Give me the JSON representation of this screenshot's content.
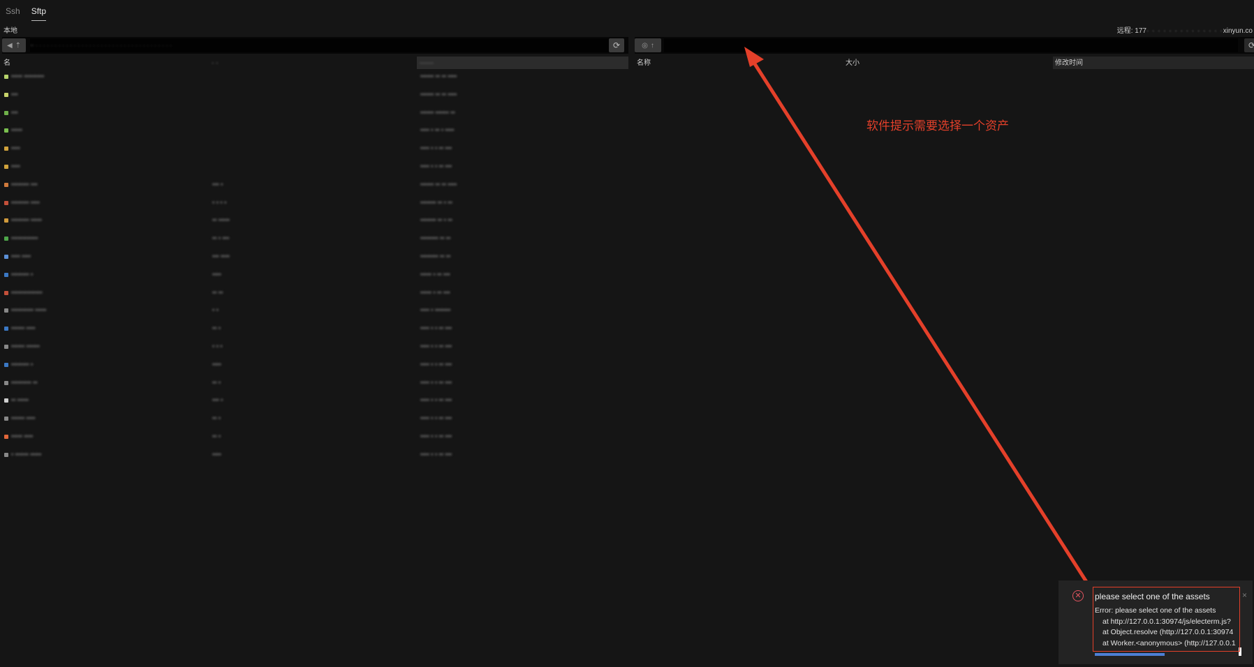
{
  "tabs": [
    {
      "label": "Ssh",
      "active": false
    },
    {
      "label": "Sftp",
      "active": true
    }
  ],
  "local": {
    "label": "本地",
    "path_blurred": "~ · · · · · · · · · · · · · · · · · · · · · · · · · · · · · · · · · · · ·",
    "headers": {
      "name": "名",
      "size": "· ·",
      "time": "······"
    }
  },
  "remote": {
    "label_prefix": "远程: 177",
    "label_host_blurred": "· · · · · · · · · · · · · ·",
    "label_suffix": "xinyun.co",
    "headers": {
      "name": "名称",
      "size": "大小",
      "time": "修改时间"
    }
  },
  "files": [
    {
      "icon": "folder-icon",
      "color": "#b6d36b",
      "name": "▪▪▪▪▪ ▪▪▪▪▪▪▪▪▪",
      "size": "",
      "time": "▪▪▪▪▪▪ ▪▪ ▪▪ ▪▪▪▪"
    },
    {
      "icon": "folder-icon",
      "color": "#c7d36b",
      "name": "▪▪▪",
      "size": "",
      "time": "▪▪▪▪▪▪ ▪▪ ▪▪ ▪▪▪▪"
    },
    {
      "icon": "folder-icon",
      "color": "#6fb14a",
      "name": "▪▪▪",
      "size": "",
      "time": "▪▪▪▪▪▪ ▪▪▪▪▪▪ ▪▪"
    },
    {
      "icon": "folder-icon",
      "color": "#7ac04f",
      "name": "▪▪▪▪▪",
      "size": "",
      "time": "▪▪▪▪ ▪ ▪▪ ▪ ▪▪▪▪"
    },
    {
      "icon": "folder-icon",
      "color": "#d0a23c",
      "name": "▪▪▪▪",
      "size": "",
      "time": "▪▪▪▪ ▪ ▪ ▪▪ ▪▪▪"
    },
    {
      "icon": "folder-icon",
      "color": "#d0a23c",
      "name": "▪▪▪▪",
      "size": "",
      "time": "▪▪▪▪ ▪ ▪ ▪▪ ▪▪▪"
    },
    {
      "icon": "code-file-icon",
      "color": "#d07a3c",
      "name": "▪▪▪▪▪▪▪▪ ▪▪▪",
      "size": "▪▪▪ ▪",
      "time": "▪▪▪▪▪▪ ▪▪ ▪▪ ▪▪▪▪"
    },
    {
      "icon": "file-icon",
      "color": "#c4503a",
      "name": "▪▪▪▪▪▪▪▪ ▪▪▪▪",
      "size": "▪ ▪ ▪ ▪",
      "time": "▪▪▪▪▪▪▪ ▪▪ ▪ ▪▪"
    },
    {
      "icon": "file-icon",
      "color": "#d09a3c",
      "name": "▪▪▪▪▪▪▪▪ ▪▪▪▪▪",
      "size": "▪▪ ▪▪▪▪▪",
      "time": "▪▪▪▪▪▪▪ ▪▪ ▪ ▪▪"
    },
    {
      "icon": "file-icon",
      "color": "#4ea64a",
      "name": "▪▪▪▪▪▪▪▪▪▪▪▪",
      "size": "▪▪ ▪ ▪▪▪",
      "time": "▪▪▪▪▪▪▪▪ ▪▪ ▪▪"
    },
    {
      "icon": "file-icon",
      "color": "#5b8fd6",
      "name": "▪▪▪▪ ▪▪▪▪",
      "size": "▪▪▪ ▪▪▪▪",
      "time": "▪▪▪▪▪▪▪▪ ▪▪ ▪▪"
    },
    {
      "icon": "ts-file-icon",
      "color": "#3b78c4",
      "name": "▪▪▪▪▪▪▪▪ ▪",
      "size": "▪▪▪▪",
      "time": "▪▪▪▪▪ ▪ ▪▪ ▪▪▪"
    },
    {
      "icon": "file-icon",
      "color": "#c4503a",
      "name": "▪▪▪▪▪▪▪▪▪▪▪▪▪▪",
      "size": "▪▪ ▪▪",
      "time": "▪▪▪▪▪ ▪ ▪▪ ▪▪▪"
    },
    {
      "icon": "file-icon",
      "color": "#888888",
      "name": "▪▪▪▪▪▪▪▪▪▪ ▪▪▪▪▪",
      "size": "▪ ▪",
      "time": "▪▪▪▪ ▪ ▪▪▪▪▪▪▪"
    },
    {
      "icon": "ts-file-icon",
      "color": "#3b78c4",
      "name": "▪▪▪▪▪▪ ▪▪▪▪",
      "size": "▪▪ ▪",
      "time": "▪▪▪▪ ▪ ▪ ▪▪ ▪▪▪"
    },
    {
      "icon": "file-icon",
      "color": "#888888",
      "name": "▪▪▪▪▪▪ ▪▪▪▪▪▪",
      "size": "▪ ▪ ▪",
      "time": "▪▪▪▪ ▪ ▪ ▪▪ ▪▪▪"
    },
    {
      "icon": "ts-file-icon",
      "color": "#3b78c4",
      "name": "▪▪▪▪▪▪▪▪ ▪",
      "size": "▪▪▪▪",
      "time": "▪▪▪▪ ▪ ▪ ▪▪ ▪▪▪"
    },
    {
      "icon": "file-icon",
      "color": "#888888",
      "name": "▪▪▪▪▪▪▪▪▪ ▪▪",
      "size": "▪▪ ▪",
      "time": "▪▪▪▪ ▪ ▪ ▪▪ ▪▪▪"
    },
    {
      "icon": "blank-file-icon",
      "color": "#cfcfcf",
      "name": "▪▪ ▪▪▪▪▪",
      "size": "▪▪▪ ▪",
      "time": "▪▪▪▪ ▪ ▪ ▪▪ ▪▪▪"
    },
    {
      "icon": "file-icon",
      "color": "#888888",
      "name": "▪▪▪▪▪▪ ▪▪▪▪",
      "size": "▪▪ ▪",
      "time": "▪▪▪▪ ▪ ▪ ▪▪ ▪▪▪"
    },
    {
      "icon": "html-file-icon",
      "color": "#e0663a",
      "name": "▪▪▪▪▪ ▪▪▪▪",
      "size": "▪▪ ▪",
      "time": "▪▪▪▪ ▪ ▪ ▪▪ ▪▪▪"
    },
    {
      "icon": "file-icon",
      "color": "#888888",
      "name": "▪ ▪▪▪▪▪▪ ▪▪▪▪▪",
      "size": "▪▪▪▪",
      "time": "▪▪▪▪ ▪ ▪ ▪▪ ▪▪▪"
    }
  ],
  "annotation": {
    "text": "软件提示需要选择一个资产",
    "color": "#e4402a"
  },
  "notification": {
    "title": "please select one of the assets",
    "lines": [
      "Error: please select one of the assets",
      "at http://127.0.0.1:30974/js/electerm.js?",
      "at Object.resolve (http://127.0.0.1:30974",
      "at Worker.<anonymous> (http://127.0.0.1"
    ],
    "error_color": "#e2545f",
    "close": "×"
  }
}
